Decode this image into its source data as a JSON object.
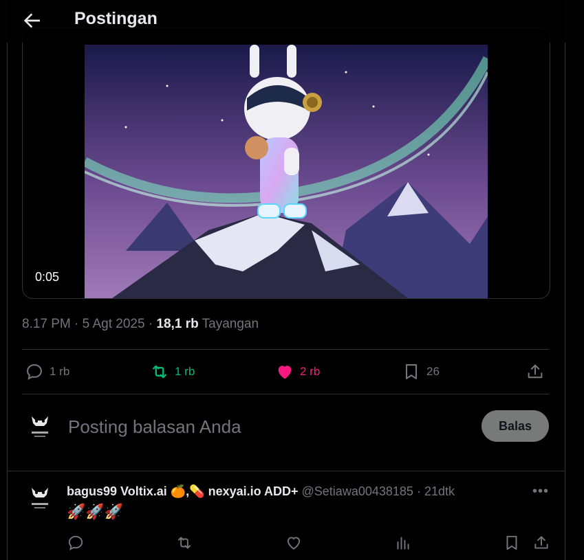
{
  "header": {
    "title": "Postingan"
  },
  "video": {
    "timestamp": "0:05"
  },
  "meta": {
    "time": "8.17 PM",
    "date": "5 Agt 2025",
    "views": "18,1 rb",
    "views_label": "Tayangan"
  },
  "actions": {
    "replies": "1 rb",
    "reposts": "1 rb",
    "likes": "2 rb",
    "bookmarks": "26"
  },
  "reply_box": {
    "placeholder": "Posting balasan Anda",
    "button": "Balas"
  },
  "reply_tweet": {
    "name_part1": "bagus99 Voltix.ai",
    "emoji1": "🍊",
    "sep": ",",
    "emoji2": "💊",
    "name_part2": "nexyai.io ADD+",
    "handle": "@Setiawa00438185",
    "dot": "·",
    "time": "21dtk",
    "text": "🚀🚀🚀"
  },
  "colors": {
    "like": "#f91880",
    "repost": "#00ba7c",
    "muted": "#71767b"
  }
}
